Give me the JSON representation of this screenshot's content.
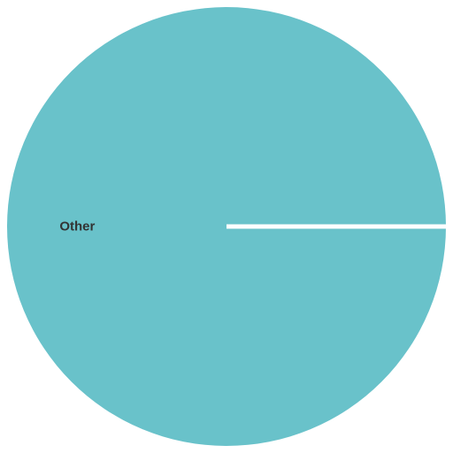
{
  "chart_data": {
    "type": "pie",
    "labels": [
      "Other"
    ],
    "values": [
      100
    ],
    "colors": [
      "#69c2ca"
    ],
    "separator_color": "#ffffff",
    "start_angle_deg": 0,
    "legend": "none"
  }
}
